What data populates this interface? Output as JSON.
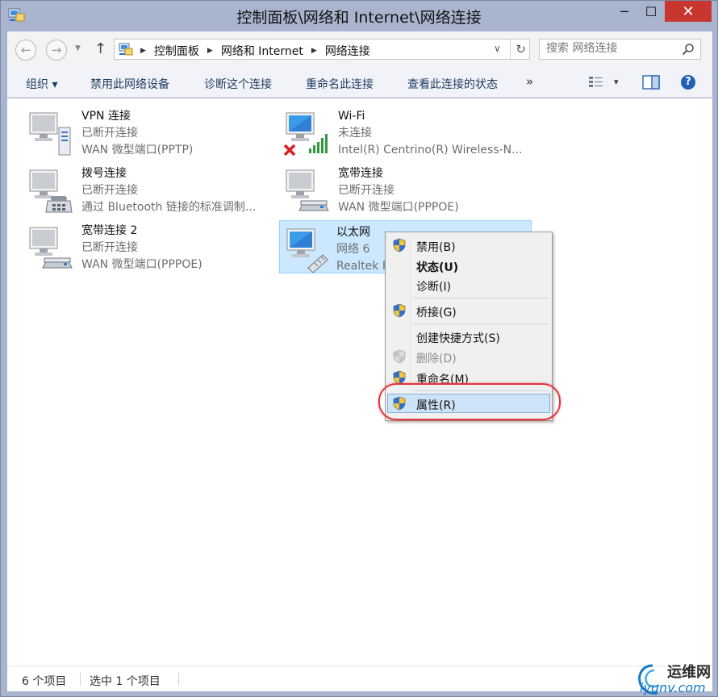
{
  "window": {
    "title": "控制面板\\网络和 Internet\\网络连接",
    "minimize": "─",
    "maximize": "☐",
    "close": "✕"
  },
  "address_bar": {
    "back": "←",
    "forward": "→",
    "history": "▼",
    "up": "↑",
    "crumbs": [
      "控制面板",
      "网络和 Internet",
      "网络连接"
    ],
    "crumb_separator": "▶",
    "dropdown": "∨",
    "refresh": "↻"
  },
  "search": {
    "placeholder": "搜索 网络连接"
  },
  "toolbar": {
    "organize": "组织 ▾",
    "disable": "禁用此网络设备",
    "diagnose": "诊断这个连接",
    "rename": "重命名此连接",
    "view_status": "查看此连接的状态",
    "more": "»",
    "view_options": "▾",
    "help": "?"
  },
  "connections": [
    {
      "name": "VPN 连接",
      "status": "已断开连接",
      "device": "WAN 微型端口(PPTP)",
      "icon": "vpn-network-icon"
    },
    {
      "name": "Wi-Fi",
      "status": "未连接",
      "device": "Intel(R) Centrino(R) Wireless-N...",
      "icon": "wifi-network-icon"
    },
    {
      "name": "拨号连接",
      "status": "已断开连接",
      "device": "通过 Bluetooth 链接的标准调制...",
      "icon": "dialup-network-icon"
    },
    {
      "name": "宽带连接",
      "status": "已断开连接",
      "device": "WAN 微型端口(PPPOE)",
      "icon": "broadband-network-icon"
    },
    {
      "name": "宽带连接 2",
      "status": "已断开连接",
      "device": "WAN 微型端口(PPPOE)",
      "icon": "broadband-network-icon"
    },
    {
      "name": "以太网",
      "status": "网络  6",
      "device": "Realtek P",
      "icon": "ethernet-network-icon"
    }
  ],
  "context_menu": {
    "items": [
      {
        "label": "禁用(B)",
        "shield": true
      },
      {
        "label": "状态(U)",
        "bold": true
      },
      {
        "label": "诊断(I)"
      },
      {
        "label": "桥接(G)",
        "shield": true
      },
      {
        "label": "创建快捷方式(S)"
      },
      {
        "label": "删除(D)",
        "disabled": true
      },
      {
        "label": "重命名(M)",
        "shield": true
      },
      {
        "label": "属性(R)",
        "shield": true,
        "highlighted": true
      }
    ]
  },
  "status_bar": {
    "item_count": "6 个项目",
    "selected_count": "选中 1 个项目"
  },
  "watermark": {
    "name": "运维网",
    "url": "iyunv.com"
  },
  "colors": {
    "selection_bg": "#cce8ff",
    "selection_border": "#99d1ff",
    "highlight_ring": "#e3343a",
    "toolbar_text": "#1e3a5f",
    "close_button": "#c7372f"
  }
}
